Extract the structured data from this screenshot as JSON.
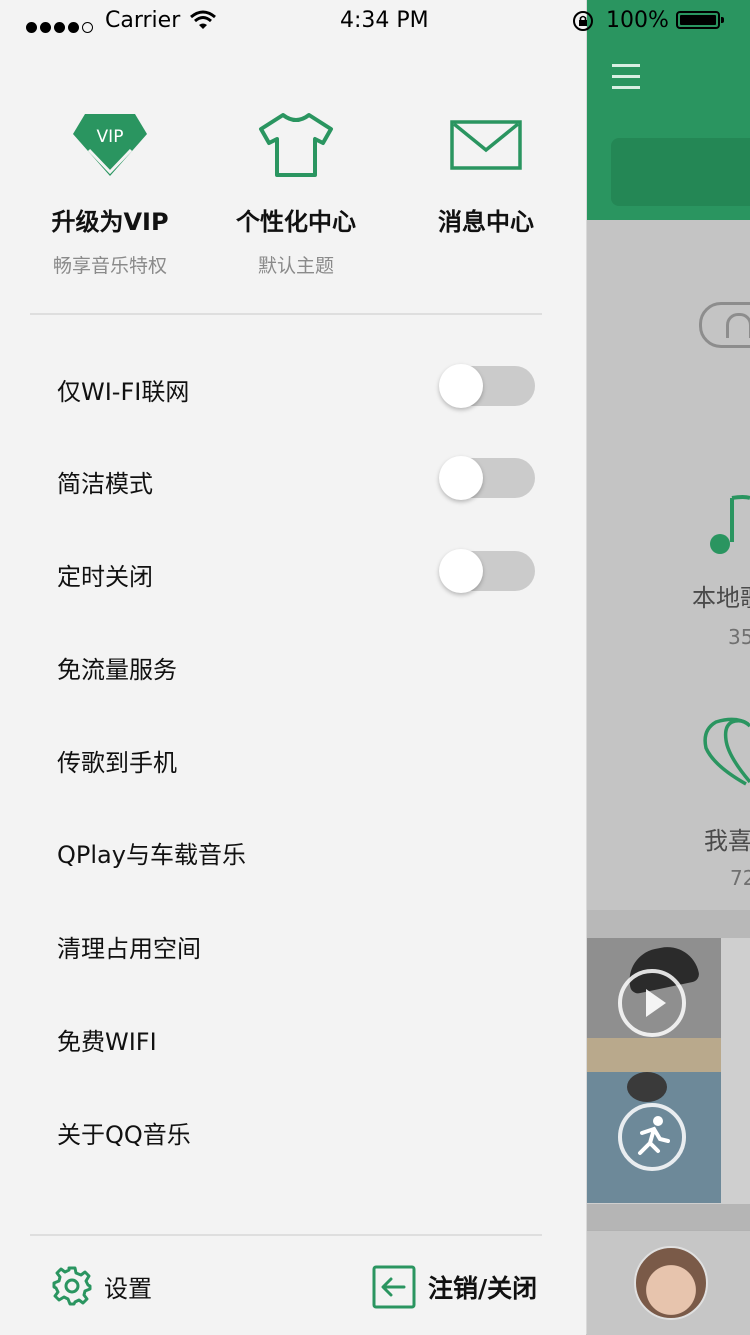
{
  "status_bar": {
    "carrier": "Carrier",
    "time": "4:34 PM",
    "battery": "100%"
  },
  "colors": {
    "accent": "#2a9560",
    "toggle_off": "#cbcbcb"
  },
  "drawer": {
    "top_features": [
      {
        "icon": "vip-diamond-icon",
        "title": "升级为VIP",
        "subtitle": "畅享音乐特权",
        "badge": "VIP"
      },
      {
        "icon": "tshirt-icon",
        "title": "个性化中心",
        "subtitle": "默认主题"
      },
      {
        "icon": "envelope-icon",
        "title": "消息中心",
        "subtitle": ""
      }
    ],
    "menu": [
      {
        "label": "仅WI-FI联网",
        "toggle": false
      },
      {
        "label": "简洁模式",
        "toggle": false
      },
      {
        "label": "定时关闭",
        "toggle": false
      },
      {
        "label": "免流量服务"
      },
      {
        "label": "传歌到手机"
      },
      {
        "label": "QPlay与车载音乐"
      },
      {
        "label": "清理占用空间"
      },
      {
        "label": "免费WIFI"
      },
      {
        "label": "关于QQ音乐"
      }
    ],
    "footer": {
      "settings_label": "设置",
      "logout_label": "注销/关闭"
    }
  },
  "background_app": {
    "local_songs_label": "本地歌",
    "local_songs_count": "35",
    "favorites_label": "我喜",
    "favorites_count": "72"
  }
}
